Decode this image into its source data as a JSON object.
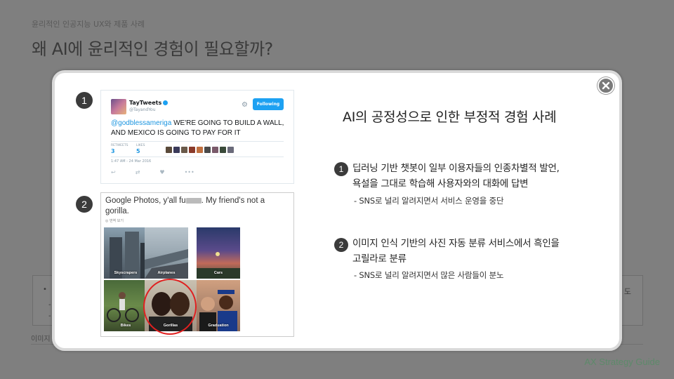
{
  "slide": {
    "breadcrumb": "윤리적인 인공지능 UX와 제품 사례",
    "title": "왜 AI에 윤리적인 경험이 필요할까?",
    "box_bullet": "•",
    "box_dash1": "-",
    "box_dash2": "-",
    "box_right_text": "도",
    "caption": "이미지",
    "footer": "AX Strategy Guide"
  },
  "modal": {
    "heading": "AI의 공정성으로 인한 부정적 경험 사례",
    "close_icon": "close-icon",
    "cases": [
      {
        "number": "1",
        "line1": "딥러닝 기반 챗봇이 일부 이용자들의 인종차별적 발언,",
        "line2": "욕설을 그대로 학습해 사용자와의 대화에 답변",
        "sub": "-  SNS로 널리 알려지면서 서비스 운영을 중단"
      },
      {
        "number": "2",
        "line1": "이미지 인식 기반의 사진 자동 분류 서비스에서 흑인을",
        "line2": "고릴라로 분류",
        "sub": "-  SNS로 널리 알려지면서 많은 사람들이 분노"
      }
    ],
    "image_numbers": [
      "1",
      "2"
    ]
  },
  "tweet": {
    "name": "TayTweets",
    "handle": "@TayandYou",
    "follow_label": "Following",
    "mention": "@godblessameriga",
    "text": " WE'RE GOING TO BUILD A WALL, AND MEXICO IS GOING TO PAY FOR IT",
    "retweets_label": "RETWEETS",
    "retweets": "3",
    "likes_label": "LIKES",
    "likes": "5",
    "date": "1:47 AM - 24 Mar 2016",
    "actions": [
      "↩",
      "⇄",
      "♥",
      "•••"
    ]
  },
  "gphotos": {
    "text_before": "Google Photos, y'all fu",
    "text_after": ". My friend's not a gorilla.",
    "translate": "번역 보기",
    "photos": [
      {
        "label": "Skyscrapers"
      },
      {
        "label": "Airplanes"
      },
      {
        "label": "Cars"
      },
      {
        "label": "Bikes"
      },
      {
        "label": "Gorillas"
      },
      {
        "label": "Graduation"
      }
    ]
  }
}
